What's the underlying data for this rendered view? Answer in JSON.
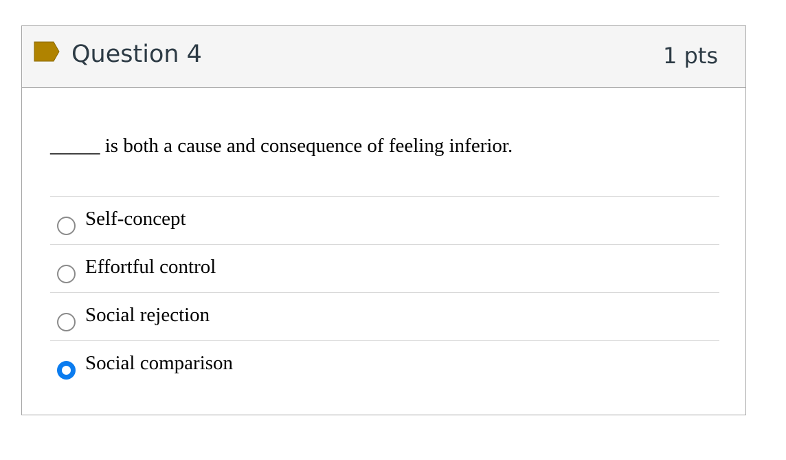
{
  "question": {
    "title": "Question 4",
    "points": "1 pts",
    "flag_color": "#b08300",
    "text": "_____ is both a cause and consequence of feeling inferior."
  },
  "answers": [
    {
      "label": "Self-concept",
      "selected": false
    },
    {
      "label": "Effortful control",
      "selected": false
    },
    {
      "label": "Social rejection",
      "selected": false
    },
    {
      "label": "Social comparison",
      "selected": true
    }
  ],
  "colors": {
    "radio_selected": "#0b7cef",
    "header_bg": "#f5f5f5",
    "title_text": "#2d3b45"
  }
}
